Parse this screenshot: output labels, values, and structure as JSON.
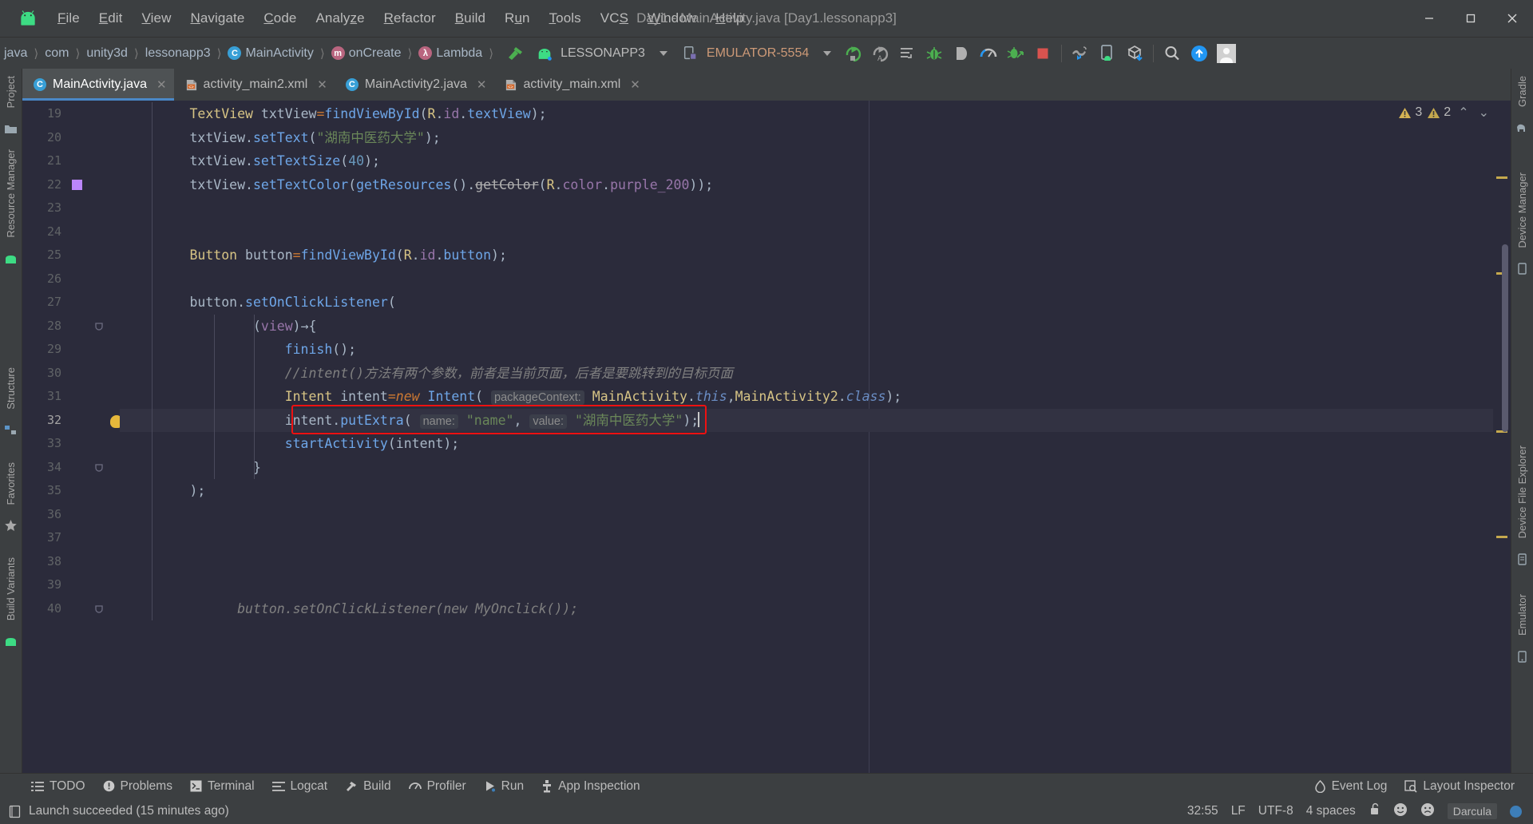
{
  "window": {
    "title": "Day1 - MainActivity.java [Day1.lessonapp3]",
    "minimize": "–",
    "maximize": "□",
    "close": "✕"
  },
  "menu": [
    {
      "label": "File",
      "mnemonic": "F"
    },
    {
      "label": "Edit",
      "mnemonic": "E"
    },
    {
      "label": "View",
      "mnemonic": "V"
    },
    {
      "label": "Navigate",
      "mnemonic": "N"
    },
    {
      "label": "Code",
      "mnemonic": "C"
    },
    {
      "label": "Analyze",
      "mnemonic": "z"
    },
    {
      "label": "Refactor",
      "mnemonic": "R"
    },
    {
      "label": "Build",
      "mnemonic": "B"
    },
    {
      "label": "Run",
      "mnemonic": "u"
    },
    {
      "label": "Tools",
      "mnemonic": "T"
    },
    {
      "label": "VCS",
      "mnemonic": "S"
    },
    {
      "label": "Window",
      "mnemonic": "W"
    },
    {
      "label": "Help",
      "mnemonic": "H"
    }
  ],
  "breadcrumbs": [
    {
      "label": "java",
      "icon": null
    },
    {
      "label": "com",
      "icon": null
    },
    {
      "label": "unity3d",
      "icon": null
    },
    {
      "label": "lessonapp3",
      "icon": null
    },
    {
      "label": "MainActivity",
      "icon": "class-badge",
      "badge": "C"
    },
    {
      "label": "onCreate",
      "icon": "method-badge",
      "badge": "m"
    },
    {
      "label": "Lambda",
      "icon": "lambda-badge",
      "badge": "λ"
    }
  ],
  "toolbar": {
    "build_icon": "hammer-icon",
    "run_config": "LESSONAPP3",
    "device": "EMULATOR-5554",
    "icons": [
      "run-icon",
      "run-with-coverage-icon",
      "apply-changes-icon",
      "debug-icon",
      "attach-debugger-icon",
      "profiler-icon",
      "apply-code-changes-icon",
      "stop-icon",
      "sdk-manager-icon",
      "avd-manager-icon",
      "sync-gradle-icon",
      "search-icon",
      "update-icon",
      "avatar-icon"
    ]
  },
  "tabs": [
    {
      "label": "MainActivity.java",
      "icon": "java-class-icon",
      "active": true,
      "close": "✕"
    },
    {
      "label": "activity_main2.xml",
      "icon": "xml-layout-icon",
      "active": false,
      "close": "✕"
    },
    {
      "label": "MainActivity2.java",
      "icon": "java-class-icon",
      "active": false,
      "close": "✕"
    },
    {
      "label": "activity_main.xml",
      "icon": "xml-layout-icon",
      "active": false,
      "close": "✕"
    }
  ],
  "left_stripe": [
    {
      "label": "Project",
      "name": "tool-window-project"
    },
    {
      "label": "Resource Manager",
      "name": "tool-window-resource-manager"
    },
    {
      "label": "Structure",
      "name": "tool-window-structure"
    },
    {
      "label": "Favorites",
      "name": "tool-window-favorites"
    },
    {
      "label": "Build Variants",
      "name": "tool-window-build-variants"
    }
  ],
  "right_stripe": [
    {
      "label": "Gradle",
      "name": "tool-window-gradle"
    },
    {
      "label": "Device Manager",
      "name": "tool-window-device-manager"
    },
    {
      "label": "Device File Explorer",
      "name": "tool-window-device-file-explorer"
    },
    {
      "label": "Emulator",
      "name": "tool-window-emulator"
    }
  ],
  "inspections": {
    "warnings": "3",
    "weak_warnings": "2",
    "prev_label": "⌃",
    "next_label": "⌄"
  },
  "editor": {
    "first_line": 19,
    "current_line": 32,
    "lines": [
      {
        "n": 19,
        "html": "        <span class='typ'>TextView</span> <span class='pln'>txtView</span><span class='kw'>=</span><span class='fn'>findViewById</span><span class='pln'>(</span><span class='typ'>R</span><span class='pln'>.</span><span class='fld'>id</span><span class='pln'>.</span><span class='fn'>textView</span><span class='pln'>);</span>"
      },
      {
        "n": 20,
        "html": "        <span class='pln'>txtView.</span><span class='fn'>setText</span><span class='pln'>(</span><span class='str'>\"湖南中医药大学\"</span><span class='pln'>);</span>"
      },
      {
        "n": 21,
        "html": "        <span class='pln'>txtView.</span><span class='fn'>setTextSize</span><span class='pln'>(</span><span class='num'>40</span><span class='pln'>);</span>"
      },
      {
        "n": 22,
        "html": "        <span class='pln'>txtView.</span><span class='fn'>setTextColor</span><span class='pln'>(</span><span class='fn'>getResources</span><span class='pln'>().</span><span class='strike'>getColor</span><span class='pln'>(</span><span class='typ'>R</span><span class='pln'>.</span><span class='fld'>color</span><span class='pln'>.</span><span class='fld'>purple_200</span><span class='pln'>));</span>"
      },
      {
        "n": 23,
        "html": ""
      },
      {
        "n": 24,
        "html": ""
      },
      {
        "n": 25,
        "html": "        <span class='typ'>Button</span> <span class='pln'>button</span><span class='kw'>=</span><span class='fn'>findViewById</span><span class='pln'>(</span><span class='typ'>R</span><span class='pln'>.</span><span class='fld'>id</span><span class='pln'>.</span><span class='fn'>button</span><span class='pln'>);</span>"
      },
      {
        "n": 26,
        "html": ""
      },
      {
        "n": 27,
        "html": "        <span class='pln'>button.</span><span class='fn'>setOnClickListener</span><span class='pln'>(</span>"
      },
      {
        "n": 28,
        "html": "                <span class='pln'>(</span><span class='fld'>view</span><span class='pln'>)→{</span>"
      },
      {
        "n": 29,
        "html": "                    <span class='fn'>finish</span><span class='pln'>();</span>"
      },
      {
        "n": 30,
        "html": "                    <span class='cmt'>//intent()方法有两个参数，前者是当前页面，后者是要跳转到的目标页面</span>"
      },
      {
        "n": 31,
        "html": "                    <span class='typ'>Intent</span> <span class='pln'>intent</span><span class='kw'>=</span><span class='kw ital'>new</span> <span class='fn'>Intent</span><span class='pln'>(</span> <span class='hint'>packageContext:</span> <span class='typ'>MainActivity</span><span class='pln'>.</span><span class='kw2 ital'>this</span><span class='pln'>,</span><span class='typ'>MainActivity2</span><span class='pln'>.</span><span class='kw2 ital'>class</span><span class='pln'>);</span>"
      },
      {
        "n": 32,
        "html": "                    <span class='pln'>intent.</span><span class='fn'>putExtra</span><span class='pln'>(</span> <span class='hint'>name:</span> <span class='str'>\"name\"</span><span class='pln'>,</span> <span class='hint'>value:</span> <span class='str'>\"湖南中医药大学\"</span><span class='pln'>);</span><span class='cursor'></span>"
      },
      {
        "n": 33,
        "html": "                    <span class='fn'>startActivity</span><span class='pln'>(intent);</span>"
      },
      {
        "n": 34,
        "html": "                <span class='pln'>}</span>"
      },
      {
        "n": 35,
        "html": "        <span class='pln'>);</span>"
      },
      {
        "n": 36,
        "html": ""
      },
      {
        "n": 37,
        "html": ""
      },
      {
        "n": 38,
        "html": ""
      },
      {
        "n": 39,
        "html": ""
      },
      {
        "n": 40,
        "html": "        <span class='cmt'>      button.setOnClickListener(new MyOnclick());</span>"
      }
    ],
    "plain_lines": [
      "        TextView txtView=findViewById(R.id.textView);",
      "        txtView.setText(\"湖南中医药大学\");",
      "        txtView.setTextSize(40);",
      "        txtView.setTextColor(getResources().getColor(R.color.purple_200));",
      "",
      "",
      "        Button button=findViewById(R.id.button);",
      "",
      "        button.setOnClickListener(",
      "                (view)→{",
      "                    finish();",
      "                    //intent()方法有两个参数，前者是当前页面，后者是要跳转到的目标页面",
      "                    Intent intent=new Intent( packageContext: MainActivity.this,MainActivity2.class);",
      "                    intent.putExtra( name: \"name\", value: \"湖南中医药大学\");",
      "                    startActivity(intent);",
      "                }",
      "        );",
      "",
      "",
      "",
      "",
      "        //      button.setOnClickListener(new MyOnclick());"
    ],
    "gutter_markers": [
      {
        "line": 22,
        "type": "color-swatch",
        "color": "#bb86fc"
      },
      {
        "line": 32,
        "type": "intention-bulb",
        "color": "#e5b73b"
      }
    ]
  },
  "tool_windows": [
    {
      "label": "TODO",
      "icon": "todo-icon"
    },
    {
      "label": "Problems",
      "icon": "problems-icon"
    },
    {
      "label": "Terminal",
      "icon": "terminal-icon"
    },
    {
      "label": "Logcat",
      "icon": "logcat-icon"
    },
    {
      "label": "Build",
      "icon": "build-hammer-icon"
    },
    {
      "label": "Profiler",
      "icon": "profiler-icon"
    },
    {
      "label": "Run",
      "icon": "run-icon"
    },
    {
      "label": "App Inspection",
      "icon": "app-inspection-icon"
    }
  ],
  "tool_windows_right": [
    {
      "label": "Event Log",
      "icon": "event-log-icon"
    },
    {
      "label": "Layout Inspector",
      "icon": "layout-inspector-icon"
    }
  ],
  "status": {
    "message": "Launch succeeded (15 minutes ago)",
    "caret": "32:55",
    "line_sep": "LF",
    "encoding": "UTF-8",
    "indent": "4 spaces",
    "lock_icon": "unlocked-icon",
    "happy_icon": "happy-face-icon",
    "sad_icon": "sad-face-icon",
    "theme": "Darcula"
  },
  "colors": {
    "editor_bg": "#2b2b3b",
    "chrome_bg": "#3c3f41",
    "accent": "#4a88c7",
    "highlight_box": "#ee1111",
    "warning": "#d4b253"
  }
}
